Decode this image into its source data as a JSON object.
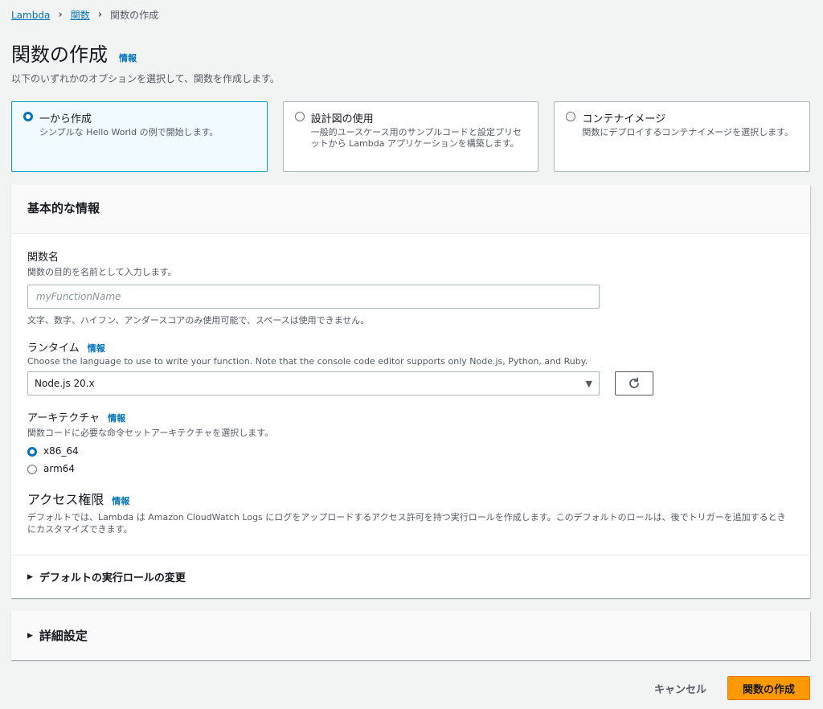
{
  "breadcrumb": {
    "items": [
      "Lambda",
      "関数"
    ],
    "current": "関数の作成"
  },
  "page": {
    "title": "関数の作成",
    "info": "情報",
    "subtitle": "以下のいずれかのオプションを選択して、関数を作成します。"
  },
  "options": [
    {
      "title": "一から作成",
      "desc": "シンプルな Hello World の例で開始します。",
      "selected": true
    },
    {
      "title": "設計図の使用",
      "desc": "一般的ユースケース用のサンプルコードと設定プリセットから Lambda アプリケーションを構築します。",
      "selected": false
    },
    {
      "title": "コンテナイメージ",
      "desc": "関数にデプロイするコンテナイメージを選択します。",
      "selected": false
    }
  ],
  "basic": {
    "header": "基本的な情報",
    "function_name": {
      "label": "関数名",
      "desc": "関数の目的を名前として入力します。",
      "placeholder": "myFunctionName",
      "value": "",
      "constraint": "文字、数字、ハイフン、アンダースコアのみ使用可能で、スペースは使用できません。"
    },
    "runtime": {
      "label": "ランタイム",
      "info": "情報",
      "desc": "Choose the language to use to write your function. Note that the console code editor supports only Node.js, Python, and Ruby.",
      "selected": "Node.js 20.x"
    },
    "architecture": {
      "label": "アーキテクチャ",
      "info": "情報",
      "desc": "関数コードに必要な命令セットアーキテクチャを選択します。",
      "options": [
        "x86_64",
        "arm64"
      ],
      "selected": "x86_64"
    },
    "permissions": {
      "title": "アクセス権限",
      "info": "情報",
      "desc": "デフォルトでは、Lambda は Amazon CloudWatch Logs にログをアップロードするアクセス許可を持つ実行ロールを作成します。このデフォルトのロールは、後でトリガーを追加するときにカスタマイズできます。"
    },
    "role_expander": "デフォルトの実行ロールの変更"
  },
  "advanced": {
    "label": "詳細設定"
  },
  "actions": {
    "cancel": "キャンセル",
    "create": "関数の作成"
  },
  "colors": {
    "accent": "#0073bb",
    "primary_button": "#ff9900",
    "selected_border": "#00a1c9"
  }
}
